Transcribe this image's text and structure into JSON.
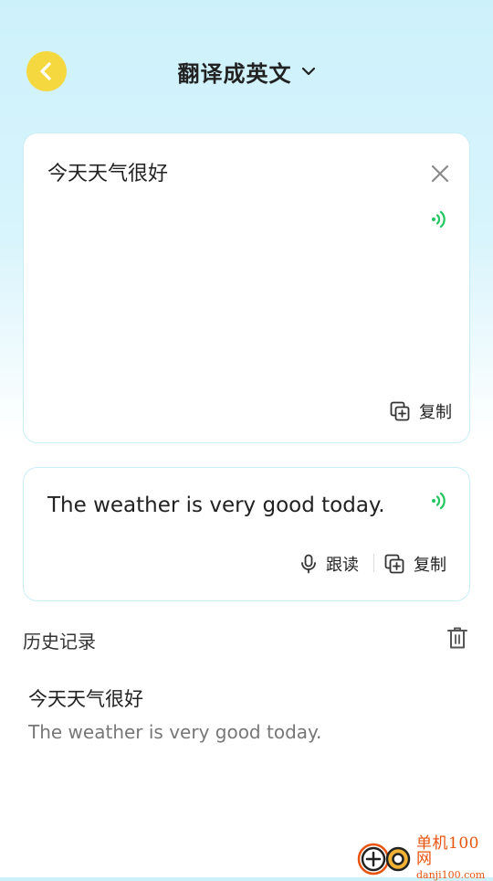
{
  "header": {
    "title": "翻译成英文",
    "back_icon": "chevron-left-icon",
    "dropdown_icon": "chevron-down-icon",
    "back_color": "#f5d840"
  },
  "source_card": {
    "text": "今天天气很好",
    "clear_icon": "close-icon",
    "speak_icon": "speaker-icon",
    "copy_label": "复制"
  },
  "result_card": {
    "text": "The weather is very good today.",
    "speak_icon": "speaker-icon",
    "read_along_label": "跟读",
    "copy_label": "复制"
  },
  "history": {
    "label": "历史记录",
    "clear_icon": "trash-icon",
    "items": [
      {
        "source": "今天天气很好",
        "target": "The weather is very good today."
      }
    ]
  },
  "watermark": {
    "name": "单机100网",
    "url": "danji100.com"
  },
  "colors": {
    "accent_green": "#22c55e",
    "card_border": "#c9eef8",
    "watermark_orange": "#e8540f"
  }
}
